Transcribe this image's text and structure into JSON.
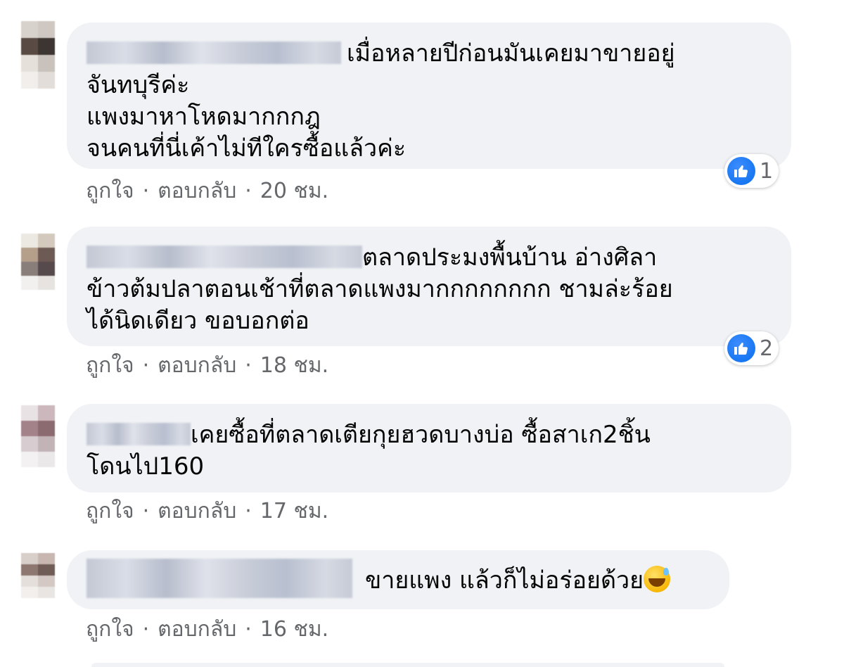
{
  "comments": [
    {
      "text": "เมื่อหลายปีก่อนมันเคยมาขายอยู่\nจันทบุรีค่ะ\nแพงมาหาโหดมากกกฎ\nจนคนที่นี่เค้าไม่ทีใครซื้อแล้วค่ะ",
      "actions": {
        "like": "ถูกใจ",
        "reply": "ตอบกลับ",
        "separator": "·",
        "time": "20 ชม."
      },
      "reaction_count": "1"
    },
    {
      "text": "ตลาดประมงพื้นบ้าน อ่างศิลา\nข้าวต้มปลาตอนเช้าที่ตลาดแพงมากกกกกกกก ชามล่ะร้อย\nได้นิดเดียว ขอบอกต่อ",
      "actions": {
        "like": "ถูกใจ",
        "reply": "ตอบกลับ",
        "separator": "·",
        "time": "18 ชม."
      },
      "reaction_count": "2"
    },
    {
      "text": "เคยซื้อที่ตลาดเตียกุยฮวดบางบ่อ ซื้อสาเก2ชิ้น\nโดนไป160",
      "actions": {
        "like": "ถูกใจ",
        "reply": "ตอบกลับ",
        "separator": "·",
        "time": "17 ชม."
      }
    },
    {
      "text": "ขายแพง แล้วก็ไม่อร่อยด้วย",
      "emoji": "grinning-sweat-emoji",
      "actions": {
        "like": "ถูกใจ",
        "reply": "ตอบกลับ",
        "separator": "·",
        "time": "16 ชม."
      }
    }
  ],
  "colors": {
    "bubble": "#f0f2f5",
    "text": "#050505",
    "meta": "#65676b",
    "like_blue": "#1877f2"
  },
  "icons": {
    "reaction": "like-thumb-icon"
  }
}
